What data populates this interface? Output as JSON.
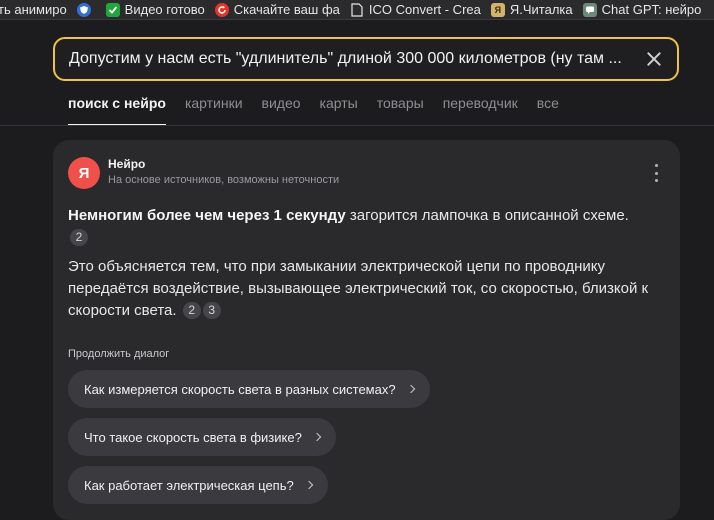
{
  "bookmarks": [
    {
      "label": "ть анимиро",
      "icon": "none",
      "color": ""
    },
    {
      "label": "",
      "icon": "shield-icon",
      "color": "#2f6fd6"
    },
    {
      "label": "Видео готово",
      "icon": "checkbox-icon",
      "color": "#1fa83a"
    },
    {
      "label": "Скачайте ваш фа",
      "icon": "refresh-icon",
      "color": "#e4342a"
    },
    {
      "label": "ICO Convert - Crea",
      "icon": "file-icon",
      "color": "#2b2b2e"
    },
    {
      "label": "Я.Читалка",
      "icon": "reader-icon",
      "color": "#d4b26a"
    },
    {
      "label": "Chat GPT: нейро",
      "icon": "chat-icon",
      "color": "#6c8a7a"
    }
  ],
  "search": {
    "query": "Допустим у насм есть \"удлинитель\" длиной 300 000 километров (ну там ...",
    "clear_label": "×"
  },
  "tabs": [
    "поиск с нейро",
    "картинки",
    "видео",
    "карты",
    "товары",
    "переводчик",
    "все"
  ],
  "active_tab": 0,
  "answer": {
    "source_name": "Нейро",
    "source_note": "На основе источников, возможны неточности",
    "avatar_letter": "Я",
    "p1_bold": "Немногим более чем через 1 секунду",
    "p1_rest": " загорится лампочка в описанной схеме.",
    "p1_refs": [
      "2"
    ],
    "p2_text": "Это объясняется тем, что при замыкании электрической цепи по проводнику передаётся воздействие, вызывающее электрический ток, со скоростью, близкой к скорости света.",
    "p2_refs": [
      "2",
      "3"
    ]
  },
  "continue": {
    "label": "Продолжить диалог",
    "suggestions": [
      "Как измеряется скорость света в разных системах?",
      "Что такое скорость света в физике?",
      "Как работает электрическая цепь?"
    ]
  },
  "colors": {
    "background": "#1c1c1e",
    "card": "#2a2a2d",
    "search_border": "#f0c24a",
    "avatar": "#f0504a",
    "chip": "#3b3b3f"
  }
}
